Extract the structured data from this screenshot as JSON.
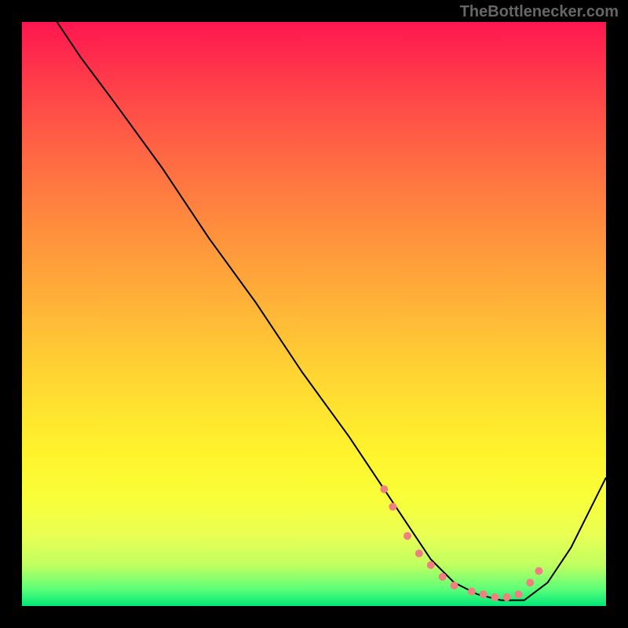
{
  "watermark": "TheBottlenecker.com",
  "chart_data": {
    "type": "line",
    "title": "",
    "xlabel": "",
    "ylabel": "",
    "xlim": [
      0,
      100
    ],
    "ylim": [
      0,
      100
    ],
    "series": [
      {
        "name": "curve",
        "x": [
          6,
          10,
          16,
          24,
          32,
          40,
          48,
          56,
          62,
          66,
          70,
          74,
          78,
          82,
          86,
          90,
          94,
          100
        ],
        "y": [
          100,
          94,
          86,
          75,
          63,
          52,
          40,
          29,
          20,
          14,
          8,
          4,
          2,
          1,
          1,
          4,
          10,
          22
        ]
      }
    ],
    "markers": {
      "name": "dots",
      "color": "#f08080",
      "x": [
        62,
        63.5,
        66,
        68,
        70,
        72,
        74,
        77,
        79,
        81,
        83,
        85,
        87,
        88.5
      ],
      "y": [
        20,
        17,
        12,
        9,
        7,
        5,
        3.5,
        2.5,
        2,
        1.5,
        1.5,
        2,
        4,
        6
      ]
    }
  }
}
